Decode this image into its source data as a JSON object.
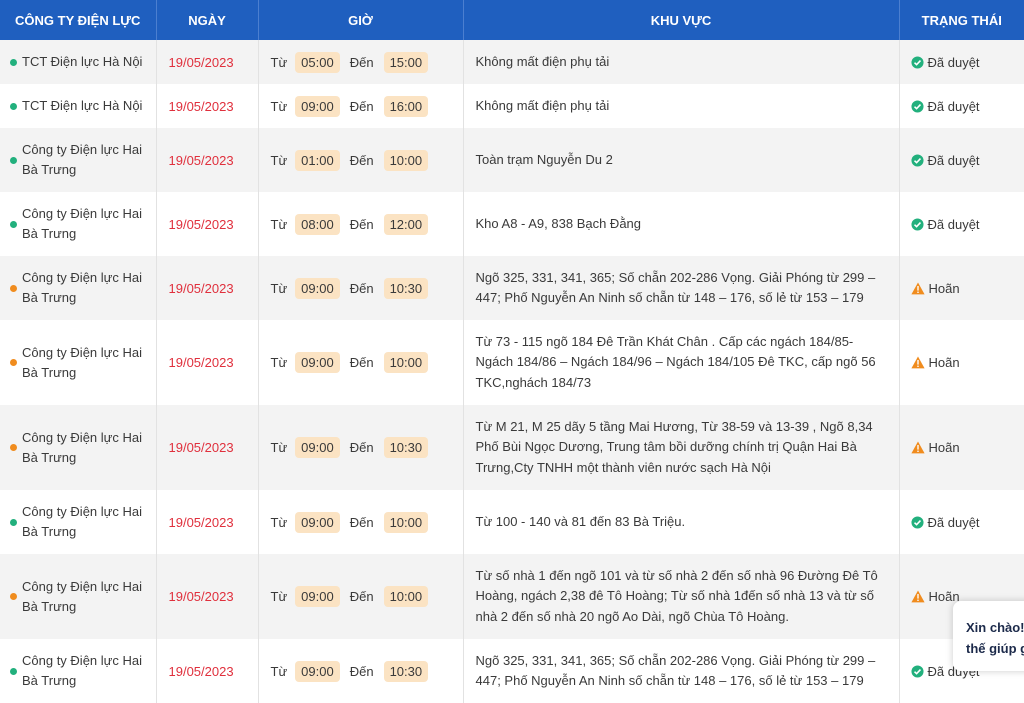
{
  "headers": {
    "company": "CÔNG TY ĐIỆN LỰC",
    "date": "NGÀY",
    "time": "GIỜ",
    "area": "KHU VỰC",
    "status": "TRẠNG THÁI"
  },
  "labels": {
    "from": "Từ",
    "to": "Đến"
  },
  "colors": {
    "header_bg": "#1f5fbf",
    "date": "#e0303d",
    "approved": "#22b07d",
    "postponed": "#f08c1e",
    "time_pill": "#fbe3c3"
  },
  "rows": [
    {
      "company": "TCT Điện lực Hà Nội",
      "dot": "green",
      "date": "19/05/2023",
      "from": "05:00",
      "to": "15:00",
      "area": "Không mất điện phụ tải",
      "status": "Đã duyệt",
      "status_type": "approved"
    },
    {
      "company": "TCT Điện lực Hà Nội",
      "dot": "green",
      "date": "19/05/2023",
      "from": "09:00",
      "to": "16:00",
      "area": "Không mất điện phụ tải",
      "status": "Đã duyệt",
      "status_type": "approved"
    },
    {
      "company": "Công ty Điện lực Hai Bà Trưng",
      "dot": "green",
      "date": "19/05/2023",
      "from": "01:00",
      "to": "10:00",
      "area": "Toàn trạm Nguyễn Du 2",
      "status": "Đã duyệt",
      "status_type": "approved"
    },
    {
      "company": "Công ty Điện lực Hai Bà Trưng",
      "dot": "green",
      "date": "19/05/2023",
      "from": "08:00",
      "to": "12:00",
      "area": "Kho A8 - A9, 838 Bạch Đằng",
      "status": "Đã duyệt",
      "status_type": "approved"
    },
    {
      "company": "Công ty Điện lực Hai Bà Trưng",
      "dot": "orange",
      "date": "19/05/2023",
      "from": "09:00",
      "to": "10:30",
      "area": "Ngõ 325, 331, 341, 365; Số chẵn 202-286 Vọng. Giải Phóng từ 299 – 447; Phố Nguyễn An Ninh số chẵn từ 148 – 176, số lẻ từ 153 – 179",
      "status": "Hoãn",
      "status_type": "postponed"
    },
    {
      "company": "Công ty Điện lực Hai Bà Trưng",
      "dot": "orange",
      "date": "19/05/2023",
      "from": "09:00",
      "to": "10:00",
      "area": "Từ 73 - 115 ngõ 184 Đê Trần Khát Chân . Cấp các ngách 184/85- Ngách 184/86 – Ngách 184/96 – Ngách 184/105 Đê TKC, cấp ngõ 56 TKC,nghách 184/73",
      "status": "Hoãn",
      "status_type": "postponed"
    },
    {
      "company": "Công ty Điện lực Hai Bà Trưng",
      "dot": "orange",
      "date": "19/05/2023",
      "from": "09:00",
      "to": "10:30",
      "area": "Từ M 21, M 25 dãy 5 tầng Mai Hương, Từ 38-59 và 13-39 , Ngõ 8,34 Phố Bùi Ngọc Dương, Trung tâm bồi dưỡng chính trị Quận Hai Bà Trưng,Cty TNHH một thành viên nước sạch Hà Nội",
      "status": "Hoãn",
      "status_type": "postponed"
    },
    {
      "company": "Công ty Điện lực Hai Bà Trưng",
      "dot": "green",
      "date": "19/05/2023",
      "from": "09:00",
      "to": "10:00",
      "area": "Từ 100 - 140 và 81 đến 83 Bà Triệu.",
      "status": "Đã duyệt",
      "status_type": "approved"
    },
    {
      "company": "Công ty Điện lực Hai Bà Trưng",
      "dot": "orange",
      "date": "19/05/2023",
      "from": "09:00",
      "to": "10:00",
      "area": "Từ số nhà 1 đến ngõ 101 và từ số nhà 2 đến số nhà 96 Đường Đê Tô Hoàng, ngách 2,38 đê Tô Hoàng; Từ số nhà 1đến số nhà 13 và từ số nhà 2 đến số nhà 20 ngõ Ao Dài, ngõ Chùa Tô Hoàng.",
      "status": "Hoãn",
      "status_type": "postponed"
    },
    {
      "company": "Công ty Điện lực Hai Bà Trưng",
      "dot": "green",
      "date": "19/05/2023",
      "from": "09:00",
      "to": "10:30",
      "area": "Ngõ 325, 331, 341, 365; Số chẵn 202-286 Vọng. Giải Phóng từ 299 – 447; Phố Nguyễn An Ninh số chẵn từ 148 – 176, số lẻ từ 153 – 179",
      "status": "Đã duyệt",
      "status_type": "approved"
    }
  ],
  "chat": {
    "line1": "Xin chào!",
    "line2": "thế giúp g"
  }
}
